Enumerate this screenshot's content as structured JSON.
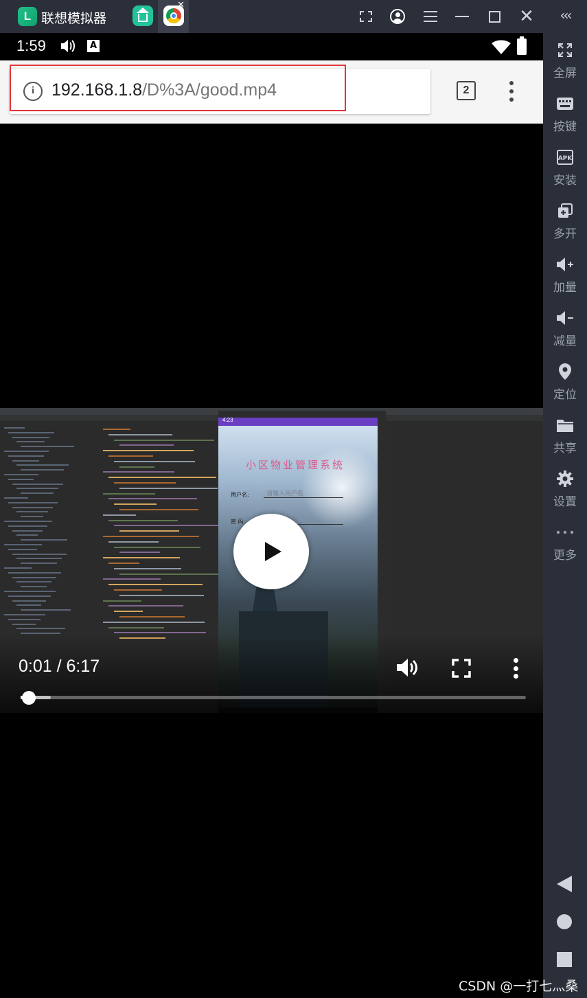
{
  "emulator": {
    "title": "联想模拟器",
    "sidebar": [
      {
        "label": "全屏",
        "icon": "fullscreen-icon"
      },
      {
        "label": "按键",
        "icon": "keyboard-icon"
      },
      {
        "label": "安装",
        "icon": "apk-icon"
      },
      {
        "label": "多开",
        "icon": "multi-instance-icon"
      },
      {
        "label": "加量",
        "icon": "volume-up-icon"
      },
      {
        "label": "减量",
        "icon": "volume-down-icon"
      },
      {
        "label": "定位",
        "icon": "location-pin-icon"
      },
      {
        "label": "共享",
        "icon": "folder-icon"
      },
      {
        "label": "设置",
        "icon": "gear-icon"
      },
      {
        "label": "更多",
        "icon": "more-dots-icon"
      }
    ],
    "apk_icon_text": "APK"
  },
  "statusbar": {
    "time": "1:59",
    "a_badge": "A"
  },
  "browser": {
    "url_host": "192.168.1.8",
    "url_path": "/D%3A/good.mp4",
    "tab_count": "2"
  },
  "video": {
    "current_time": "0:01",
    "duration": "6:17",
    "time_separator": " / ",
    "progress": 0.003,
    "buffered": 0.06,
    "phone_app_title": "小区物业管理系统",
    "phone_username_label": "用户名:",
    "phone_username_hint": "请输入用户名",
    "phone_password_label": "密  码:",
    "phone_password_hint": "请输入密码",
    "phone_clock": "4:23"
  },
  "watermark": "CSDN @一打七灬桑"
}
